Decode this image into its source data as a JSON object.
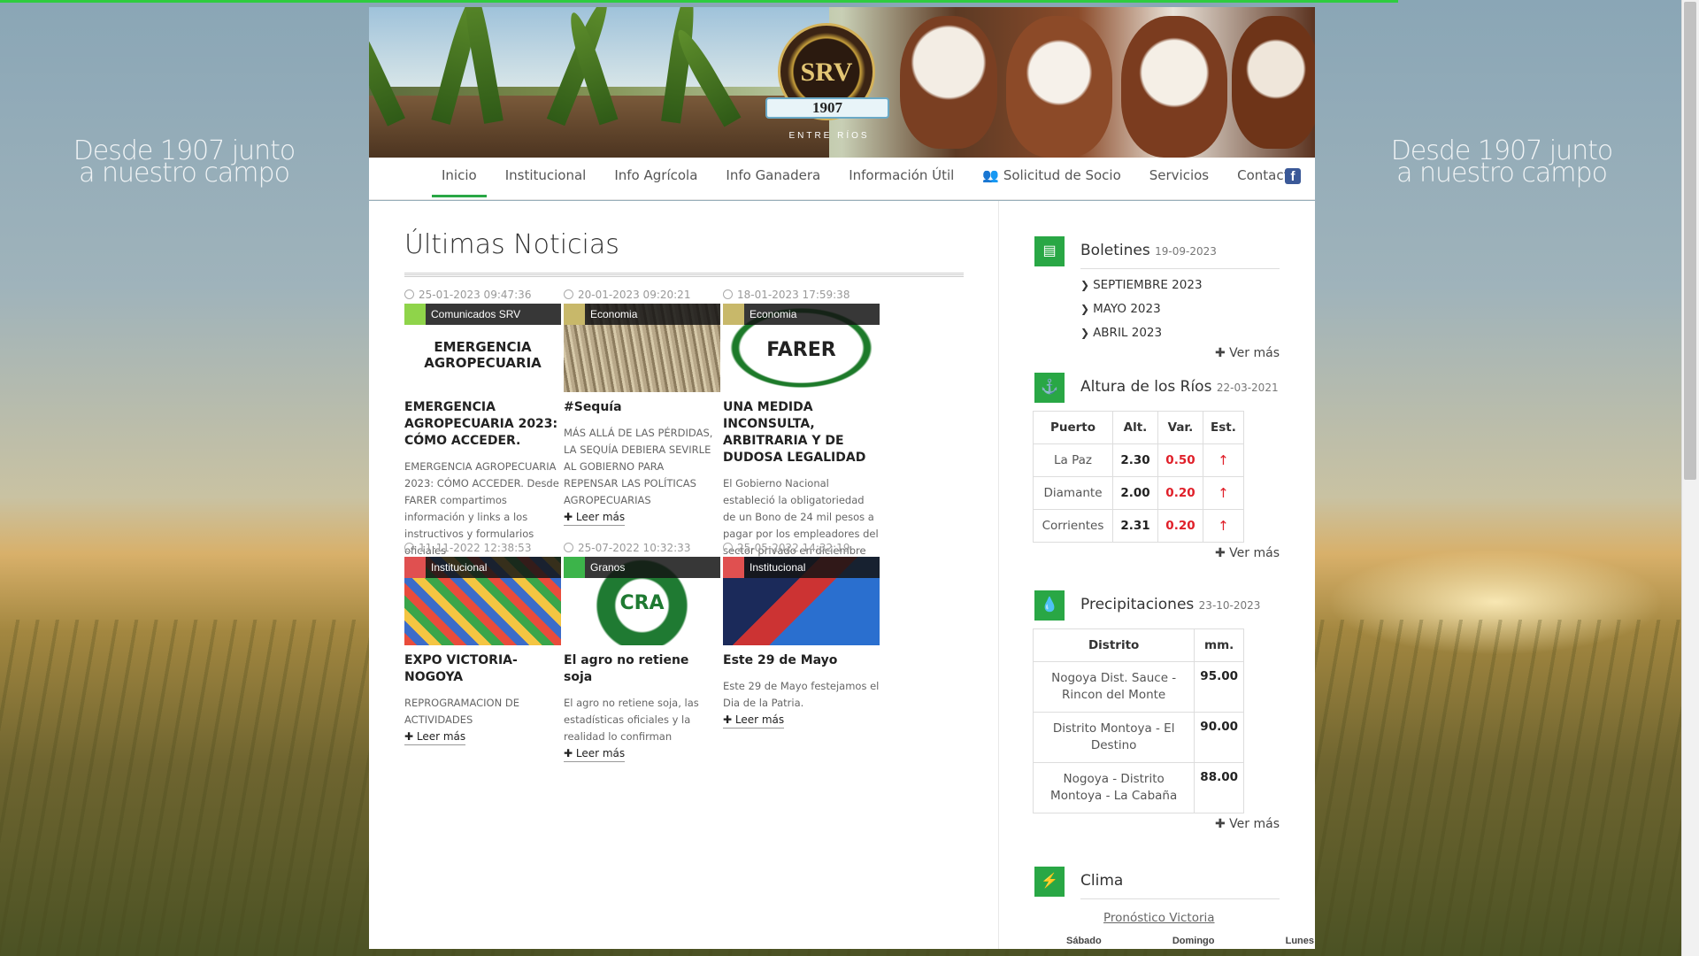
{
  "slogan": {
    "left": "Desde 1907 junto a nuestro campo",
    "right": "Desde 1907 junto a nuestro campo"
  },
  "logo": {
    "monogram": "SRV",
    "year": "1907",
    "sub": "ENTRE RÍOS"
  },
  "nav": {
    "items": [
      "Inicio",
      "Institucional",
      "Info Agrícola",
      "Info Ganadera",
      "Información Útil",
      "Solicitud de Socio",
      "Servicios",
      "Contacto"
    ],
    "active": "Inicio"
  },
  "news": {
    "title": "Últimas Noticias",
    "read_more": "Leer más",
    "items": [
      {
        "date": "25-01-2023 09:47:36",
        "tag": "Comunicados SRV",
        "tag_color": "#8fd44a",
        "title": "EMERGENCIA AGROPECUARIA 2023: CÓMO ACCEDER.",
        "excerpt": "EMERGENCIA AGROPECUARIA 2023: CÓMO ACCEDER. Desde FARER compartimos información y links a los instructivos y formularios oficiales",
        "thumb_text": "EMERGENCIA AGROPECUARIA"
      },
      {
        "date": "20-01-2023 09:20:21",
        "tag": "Economia",
        "tag_color": "#c8b86a",
        "title": "#Sequía",
        "excerpt": "MÁS ALLÁ DE LAS PÉRDIDAS, LA SEQUÍA DEBIERA SEVIRLE AL GOBIERNO PARA REPENSAR LAS POLÍTICAS AGROPECUARIAS",
        "thumb_text": ""
      },
      {
        "date": "18-01-2023 17:59:38",
        "tag": "Economia",
        "tag_color": "#c8b86a",
        "title": "UNA MEDIDA INCONSULTA, ARBITRARIA Y DE DUDOSA LEGALIDAD",
        "excerpt": "El Gobierno Nacional estableció la obligatoriedad de un Bono de 24 mil pesos a pagar por los empleadores del sector privado en diciembre",
        "thumb_text": "FARER"
      },
      {
        "date": "11-11-2022 12:38:53",
        "tag": "Institucional",
        "tag_color": "#e05050",
        "title": "EXPO VICTORIA-NOGOYA",
        "excerpt": "REPROGRAMACION DE ACTIVIDADES",
        "thumb_text": ""
      },
      {
        "date": "25-07-2022 10:32:33",
        "tag": "Granos",
        "tag_color": "#3cb44a",
        "title": "El agro no retiene soja",
        "excerpt": "El agro no retiene soja, las estadísticas oficiales y la realidad lo confirman",
        "thumb_text": "CRA"
      },
      {
        "date": "25-05-2022 14:32:19",
        "tag": "Institucional",
        "tag_color": "#e05050",
        "title": "Este 29 de Mayo",
        "excerpt": "Este 29 de Mayo festejamos el Dia de la Patria.",
        "thumb_text": ""
      }
    ]
  },
  "sidebar": {
    "ver_mas": "Ver más",
    "boletines": {
      "title": "Boletines",
      "date": "19-09-2023",
      "items": [
        "SEPTIEMBRE 2023",
        "MAYO 2023",
        "ABRIL 2023"
      ]
    },
    "rios": {
      "title": "Altura de los Ríos",
      "date": "22-03-2021",
      "headers": [
        "Puerto",
        "Alt.",
        "Var.",
        "Est."
      ],
      "rows": [
        [
          "La Paz",
          "2.30",
          "0.50",
          "↑"
        ],
        [
          "Diamante",
          "2.00",
          "0.20",
          "↑"
        ],
        [
          "Corrientes",
          "2.31",
          "0.20",
          "↑"
        ]
      ]
    },
    "precip": {
      "title": "Precipitaciones",
      "date": "23-10-2023",
      "headers": [
        "Distrito",
        "mm."
      ],
      "rows": [
        [
          "Nogoya Dist. Sauce - Rincon del Monte",
          "95.00"
        ],
        [
          "Distrito Montoya - El Destino",
          "90.00"
        ],
        [
          "Nogoya - Distrito Montoya - La Cabaña",
          "88.00"
        ]
      ]
    },
    "clima": {
      "title": "Clima",
      "link": "Pronóstico Victoria",
      "days": [
        "Sábado",
        "Domingo",
        "Lunes"
      ]
    }
  },
  "colors": {
    "accent": "#29a745",
    "alert": "#e0202a",
    "facebook": "#3b5998"
  }
}
